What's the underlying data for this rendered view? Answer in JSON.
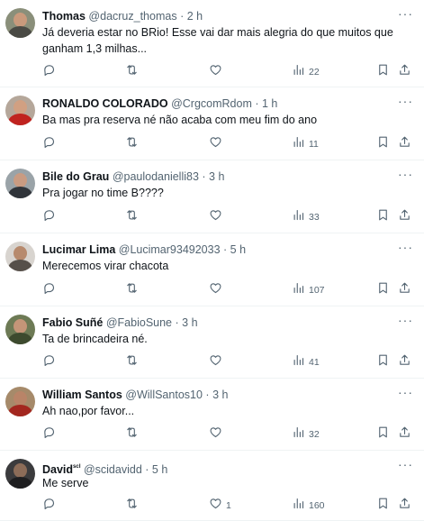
{
  "tweets": [
    {
      "name": "Thomas",
      "handle": "@dacruz_thomas",
      "dot": "·",
      "time": "2 h",
      "text": "Já deveria estar no BRio! Esse vai dar mais alegria do que muitos que\nganham 1,3 milhas...",
      "views": "22",
      "likes": "",
      "avatar_colors": {
        "bg": "#8a8f7a",
        "head": "#c99a7c",
        "body": "#4a4a44"
      }
    },
    {
      "name": "RONALDO COLORADO",
      "handle": "@CrgcomRdom",
      "dot": "·",
      "time": "1 h",
      "text": "Ba mas pra reserva né não acaba com meu fim do ano",
      "views": "11",
      "likes": "",
      "avatar_colors": {
        "bg": "#b5a79a",
        "head": "#d1a082",
        "body": "#c0231f"
      }
    },
    {
      "name": "Bile do Grau",
      "handle": "@paulodanielli83",
      "dot": "·",
      "time": "3 h",
      "text": "Pra jogar no time B????",
      "views": "33",
      "likes": "",
      "avatar_colors": {
        "bg": "#9aa3a8",
        "head": "#c99b82",
        "body": "#30343a"
      }
    },
    {
      "name": "Lucimar Lima",
      "handle": "@Lucimar93492033",
      "dot": "·",
      "time": "5 h",
      "text": "Merecemos virar chacota",
      "views": "107",
      "likes": "",
      "avatar_colors": {
        "bg": "#d8d4cf",
        "head": "#b78a6d",
        "body": "#56504a"
      }
    },
    {
      "name": "Fabio Suñé",
      "handle": "@FabioSune",
      "dot": "·",
      "time": "3 h",
      "text": "Ta de brincadeira né.",
      "views": "41",
      "likes": "",
      "avatar_colors": {
        "bg": "#6d7a55",
        "head": "#c49578",
        "body": "#3d4a2e"
      }
    },
    {
      "name": "William Santos",
      "handle": "@WillSantos10",
      "dot": "·",
      "time": "3 h",
      "text": "Ah nao,por favor...",
      "views": "32",
      "likes": "",
      "avatar_colors": {
        "bg": "#a68a6a",
        "head": "#b98468",
        "body": "#a3271f"
      }
    },
    {
      "name": "David",
      "name_suffix": "ˢᶜᴵ",
      "handle": "@scidavidd",
      "dot": "·",
      "time": "5 h",
      "text": "Me serve",
      "views": "160",
      "likes": "1",
      "avatar_colors": {
        "bg": "#3b3b3d",
        "head": "#8c6c58",
        "body": "#1e1e20"
      }
    }
  ],
  "icons": {
    "reply": "reply-icon",
    "retweet": "retweet-icon",
    "like": "heart-icon",
    "views": "views-icon",
    "bookmark": "bookmark-icon",
    "share": "share-icon",
    "more": "more-icon"
  },
  "colors": {
    "text": "#0f1419",
    "secondary": "#536471",
    "divider": "#eff3f4"
  }
}
